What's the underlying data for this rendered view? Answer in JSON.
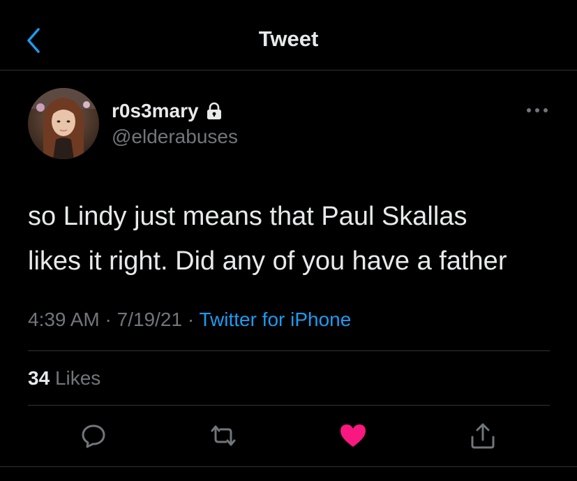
{
  "header": {
    "title": "Tweet",
    "back_icon": "chevron-left-icon",
    "accent": "#1d9bf0"
  },
  "author": {
    "display_name": "r0s3mary",
    "handle": "@elderabuses",
    "protected_icon": "lock-icon"
  },
  "tweet": {
    "text_line1": "so Lindy just means that Paul Skallas",
    "text_line2": "likes it right. Did any of you have a father",
    "time": "4:39 AM",
    "date": "7/19/21",
    "source": "Twitter for iPhone",
    "separator": "·"
  },
  "stats": {
    "likes_count": "34",
    "likes_label": "Likes"
  },
  "actions": [
    {
      "name": "reply",
      "icon": "reply-icon"
    },
    {
      "name": "retweet",
      "icon": "retweet-icon"
    },
    {
      "name": "like",
      "icon": "heart-icon",
      "active": true,
      "color": "#f91880"
    },
    {
      "name": "share",
      "icon": "share-icon"
    }
  ],
  "colors": {
    "background": "#000000",
    "text": "#e7e9ea",
    "muted": "#71767b",
    "link": "#1d9bf0",
    "like": "#f91880",
    "border": "#2f3336"
  }
}
